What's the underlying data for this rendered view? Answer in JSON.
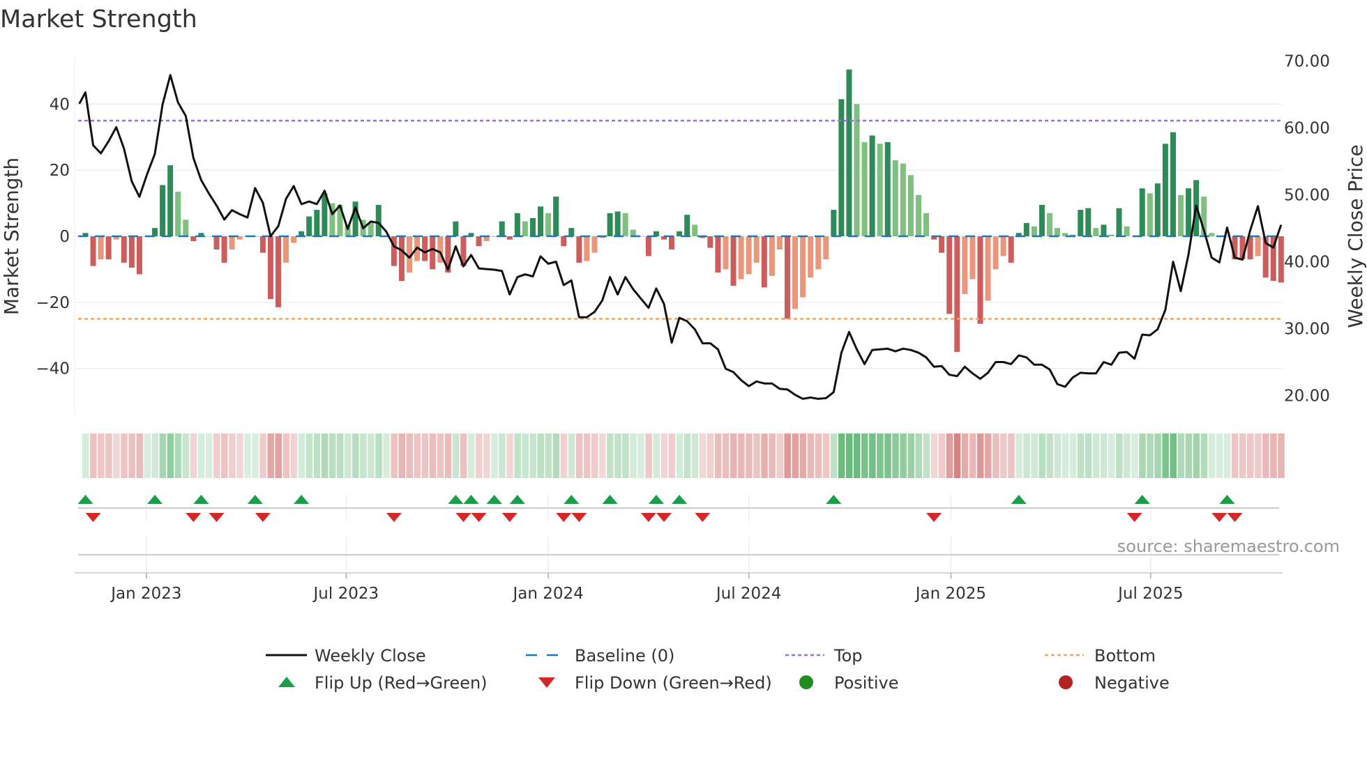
{
  "title": "Market Strength",
  "source": "source: sharemaestro.com",
  "colors": {
    "dark_green": "#2e8b57",
    "light_green": "#7fbf7f",
    "dark_red": "#cd5c5c",
    "light_red": "#e9967a",
    "top_line": "#9370db",
    "bottom_line": "#f0a460",
    "baseline": "#1f77b4",
    "flip_up": "#1a9e4a",
    "flip_down": "#d62728",
    "positive": "#228b22",
    "negative": "#b22222"
  },
  "chart_data": {
    "type": "bar",
    "title": "Market Strength",
    "ylabel": "Market Strength",
    "y2label": "Weekly Close Price",
    "ylim": [
      -55,
      55
    ],
    "y2lim": [
      15.5,
      72
    ],
    "yticks": [
      40,
      20,
      0,
      -20,
      -40
    ],
    "ytick_labels": [
      "40",
      "20",
      "0",
      "−20",
      "−40"
    ],
    "y2ticks": [
      70,
      60,
      50,
      40,
      30,
      20
    ],
    "y2tick_labels": [
      "70.00",
      "60.00",
      "50.00",
      "40.00",
      "30.00",
      "20.00"
    ],
    "top_level": 35,
    "bottom_level": -25,
    "baseline": 0,
    "xticks": [
      {
        "label": "Jan 2023",
        "week": 7.9
      },
      {
        "label": "Jul 2023",
        "week": 33.8
      },
      {
        "label": "Jan 2024",
        "week": 60
      },
      {
        "label": "Jul 2024",
        "week": 86
      },
      {
        "label": "Jan 2025",
        "week": 112.2
      },
      {
        "label": "Jul 2025",
        "week": 138.1
      }
    ],
    "strength": [
      1,
      -9,
      -7,
      -7,
      -1,
      -8,
      -9.5,
      -11.5,
      0,
      2.5,
      15.5,
      21.5,
      13.5,
      5,
      -1.5,
      1,
      0,
      -4,
      -8,
      -4,
      -1,
      0,
      0,
      -5,
      -19,
      -21.5,
      -8,
      -2,
      1.5,
      6,
      8,
      13,
      10,
      9.5,
      3.5,
      10.5,
      5,
      4,
      9.5,
      0.3,
      -9,
      -13.5,
      -11,
      -7.5,
      -7.5,
      -10,
      -8,
      -11,
      4.5,
      -9,
      1,
      -3,
      -1.5,
      0,
      4.5,
      -1,
      7,
      4.5,
      5.5,
      9,
      7,
      12,
      -3,
      2.5,
      -8,
      -7.5,
      -5,
      -0.5,
      7,
      7.5,
      7,
      2,
      0,
      -6,
      1.5,
      -1,
      -4,
      1.5,
      6.5,
      3.5,
      -0.5,
      -3.5,
      -11,
      -10,
      -15,
      -13,
      -11.5,
      -8,
      -15.5,
      -12,
      -4,
      -25,
      -22,
      -18.5,
      -12.5,
      -10,
      -7,
      8,
      41.5,
      50.5,
      40,
      28.5,
      30.5,
      28,
      28.5,
      23,
      22,
      18.5,
      12.5,
      7,
      -1,
      -5,
      -23.5,
      -35,
      -17.5,
      -13,
      -26.5,
      -19.5,
      -10,
      -6,
      -8,
      1,
      4,
      3,
      9.5,
      7,
      2.5,
      1,
      0.5,
      8,
      8.5,
      2.5,
      3.5,
      0.5,
      8.5,
      3,
      0,
      14.5,
      13,
      16,
      28,
      31.5,
      12.5,
      14.5,
      17,
      12,
      1,
      0,
      0,
      -7,
      -7,
      -7,
      -6,
      -12.5,
      -13.5,
      -14
    ],
    "weekly_close": [
      63.6,
      65.3,
      57.4,
      56.2,
      58.0,
      60.1,
      56.9,
      52.0,
      49.7,
      53.1,
      56.1,
      63.5,
      67.9,
      63.8,
      61.8,
      55.5,
      52.2,
      50.2,
      48.4,
      46.3,
      47.7,
      47.1,
      46.6,
      51.0,
      48.8,
      43.8,
      45.3,
      49.4,
      51.3,
      48.6,
      49.0,
      48.6,
      50.6,
      47.1,
      48.4,
      44.9,
      48.1,
      45.0,
      46.0,
      45.8,
      44.5,
      42.3,
      41.7,
      40.6,
      42.1,
      41.4,
      41.9,
      41.4,
      38.8,
      42.3,
      39.3,
      41.0,
      39.0,
      38.9,
      38.8,
      38.6,
      35.1,
      37.7,
      38.1,
      37.8,
      40.8,
      39.7,
      40.0,
      36.5,
      37.2,
      31.7,
      31.7,
      32.5,
      34.2,
      37.7,
      35.1,
      37.7,
      35.9,
      34.5,
      33.1,
      36.0,
      33.7,
      27.9,
      31.6,
      31.1,
      29.9,
      27.8,
      27.8,
      26.9,
      24.0,
      23.5,
      22.3,
      21.4,
      22.1,
      21.8,
      21.8,
      21.0,
      20.9,
      20.1,
      19.5,
      19.7,
      19.5,
      19.6,
      20.5,
      26.4,
      29.5,
      26.9,
      24.7,
      26.8,
      26.9,
      27.0,
      26.6,
      27.0,
      26.8,
      26.4,
      25.7,
      24.3,
      24.4,
      23.1,
      22.9,
      24.3,
      23.3,
      22.5,
      23.4,
      25.0,
      25.0,
      24.7,
      26.0,
      25.7,
      24.6,
      24.6,
      23.9,
      21.7,
      21.3,
      22.7,
      23.4,
      23.3,
      23.3,
      25.0,
      24.6,
      26.4,
      26.5,
      25.5,
      29.1,
      29.0,
      29.9,
      32.8,
      40.0,
      35.6,
      41.1,
      48.4,
      44.7,
      40.6,
      39.9,
      45.1,
      40.6,
      40.3,
      44.7,
      48.3,
      42.8,
      42.1,
      45.5
    ],
    "flip_up_weeks": [
      0,
      9,
      15,
      22,
      28,
      48,
      50,
      53,
      56,
      63,
      68,
      74,
      77,
      97,
      121,
      137,
      148
    ],
    "flip_down_weeks": [
      1,
      14,
      17,
      23,
      40,
      49,
      51,
      55,
      62,
      64,
      73,
      75,
      80,
      110,
      136,
      147,
      149
    ],
    "legend_placement": "bottom",
    "legend": [
      {
        "label": "Weekly Close",
        "kind": "line"
      },
      {
        "label": "Baseline (0)",
        "kind": "baseline"
      },
      {
        "label": "Top",
        "kind": "top"
      },
      {
        "label": "Bottom",
        "kind": "bottom"
      },
      {
        "label": "Flip Up (Red→Green)",
        "kind": "up"
      },
      {
        "label": "Flip Down (Green→Red)",
        "kind": "down"
      },
      {
        "label": "Positive",
        "kind": "pos"
      },
      {
        "label": "Negative",
        "kind": "neg"
      }
    ]
  }
}
